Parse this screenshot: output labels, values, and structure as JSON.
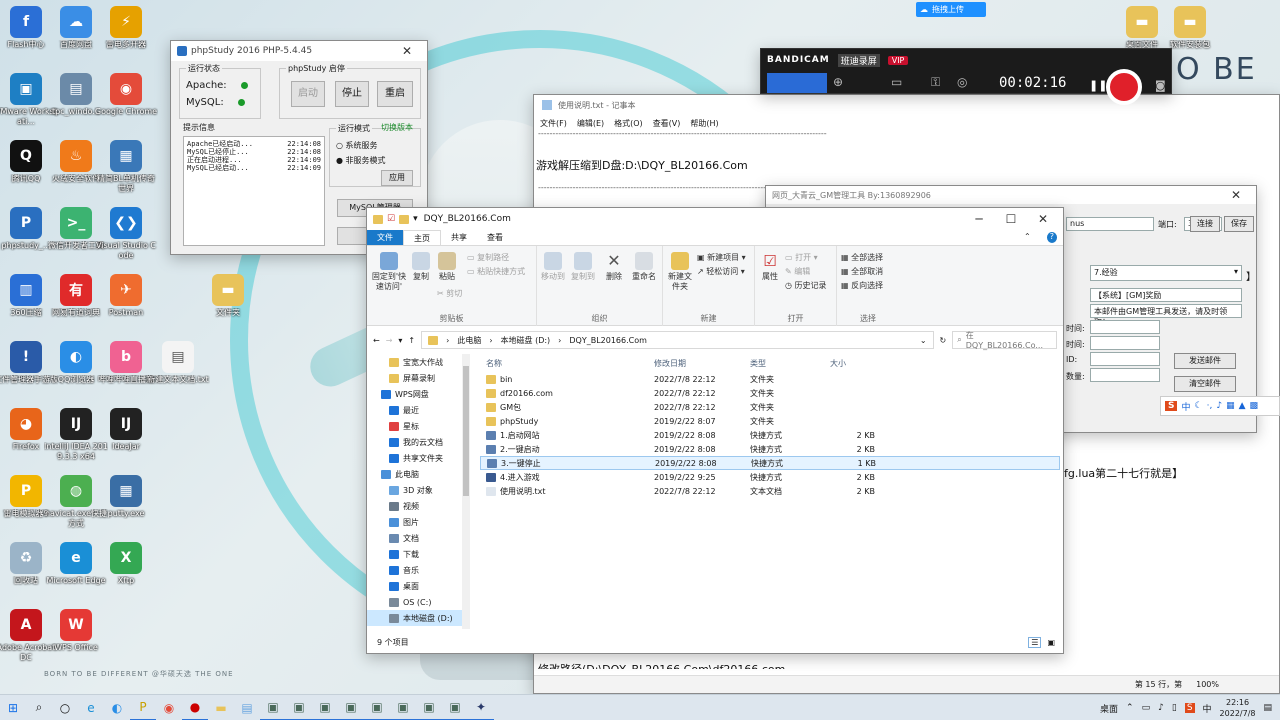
{
  "desktop": {
    "slogan": "BORN TO BE DIFFERENT @华硕天选 THE ONE",
    "icons": [
      {
        "label": "Flash中心",
        "color": "#2b6fd6",
        "glyph": "f"
      },
      {
        "label": "百度网盘",
        "color": "#3a8ee6",
        "glyph": "☁"
      },
      {
        "label": "雷电多开器",
        "color": "#e6a100",
        "glyph": "⚡"
      },
      {
        "label": "VMware Workstati...",
        "color": "#1e7fc4",
        "glyph": "▣"
      },
      {
        "label": "tpc_windo...",
        "color": "#6b8aa8",
        "glyph": "▤"
      },
      {
        "label": "Google Chrome",
        "color": "#e44b3a",
        "glyph": "◉"
      },
      {
        "label": "腾讯QQ",
        "color": "#111111",
        "glyph": "Q"
      },
      {
        "label": "火绒安全软件",
        "color": "#f07a1a",
        "glyph": "♨"
      },
      {
        "label": "精简BL单机传奇世界",
        "color": "#3a78b8",
        "glyph": "▦"
      },
      {
        "label": "phpstudy_...",
        "color": "#2a6fc0",
        "glyph": "P"
      },
      {
        "label": "微信开发者工具",
        "color": "#3cb371",
        "glyph": ">_"
      },
      {
        "label": "Visual Studio Code",
        "color": "#1f7ad1",
        "glyph": "❮❯"
      },
      {
        "label": "360压缩",
        "color": "#2a6fd6",
        "glyph": "▥"
      },
      {
        "label": "网易有道词典",
        "color": "#e02a2a",
        "glyph": "有"
      },
      {
        "label": "Postman",
        "color": "#ef6c2f",
        "glyph": "✈"
      },
      {
        "label": "文件夹",
        "color": "#e8c35a",
        "glyph": "▬"
      },
      {
        "label": "文件管理器手游版",
        "color": "#2a5ba8",
        "glyph": "!"
      },
      {
        "label": "QQ浏览器",
        "color": "#2a8ee6",
        "glyph": "◐"
      },
      {
        "label": "哔哩哔哩直播姬",
        "color": "#f06292",
        "glyph": "b"
      },
      {
        "label": "新建文本文档.txt",
        "color": "#eeeeee",
        "glyph": "▤"
      },
      {
        "label": "Firefox",
        "color": "#e8651a",
        "glyph": "◕"
      },
      {
        "label": "IntelliJ IDEA 2019.3.3 x64",
        "color": "#222222",
        "glyph": "IJ"
      },
      {
        "label": "IdeaJar",
        "color": "#222222",
        "glyph": "IJ"
      },
      {
        "label": "雷电模拟器9",
        "color": "#f2b600",
        "glyph": "P"
      },
      {
        "label": "navicat.exe快捷方式",
        "color": "#4caf50",
        "glyph": "◍"
      },
      {
        "label": "putty.exe",
        "color": "#3a6ea5",
        "glyph": "▦"
      },
      {
        "label": "回收站",
        "color": "#9bb4c8",
        "glyph": "♻"
      },
      {
        "label": "Microsoft Edge",
        "color": "#1a8fd6",
        "glyph": "e"
      },
      {
        "label": "Xftp",
        "color": "#34a853",
        "glyph": "X"
      },
      {
        "label": "Adobe Acrobat DC",
        "color": "#c4161c",
        "glyph": "A"
      },
      {
        "label": "WPS Office",
        "color": "#e53935",
        "glyph": "W"
      },
      {
        "label": "桌面文件",
        "color": "#e8c35a",
        "glyph": "▬"
      },
      {
        "label": "软件安装包",
        "color": "#e8c35a",
        "glyph": "▬"
      }
    ]
  },
  "upload_button": "拖拽上传",
  "brand_text": "O BE",
  "phpstudy": {
    "title": "phpStudy 2016  PHP-5.4.45",
    "status_legend": "运行状态",
    "apache": "Apache:",
    "mysql": "MySQL:",
    "start_legend": "phpStudy 启停",
    "start": "启动",
    "stop": "停止",
    "restart": "重启",
    "log_legend": "提示信息",
    "logs": [
      {
        "msg": "Apache已经启动...",
        "time": "22:14:08"
      },
      {
        "msg": "MySQL已经停止...",
        "time": "22:14:08"
      },
      {
        "msg": "正在启动进程...",
        "time": "22:14:09"
      },
      {
        "msg": "MySQL已经启动...",
        "time": "22:14:09"
      }
    ],
    "mode_legend": "运行模式",
    "switch_version": "切换版本",
    "mode_system": "系统服务",
    "mode_nonservice": "非服务模式",
    "apply": "应用",
    "mysql_manager": "MySQL管理器",
    "other": "其他"
  },
  "notepad": {
    "title": "使用说明.txt - 记事本",
    "menu": [
      "文件(F)",
      "编辑(E)",
      "格式(O)",
      "查看(V)",
      "帮助(H)"
    ],
    "dashes": "----------------------------------------------------------------------------------------------------",
    "line1": "游戏解压缩到D盘:D:\\DQY_BL20166.Com",
    "line_right": "cfg.lua第二十七行就是】",
    "line_bottom": "修改路径(D:\\DQY_BL20166.Com\\df20166.com",
    "status_pos": "第 15 行，第",
    "status_zoom": "100%"
  },
  "gm": {
    "title": "网页_大青云_GM管理工具 By:1360892906",
    "host_value": "nus",
    "port_label": "端口:",
    "port_value": "3306",
    "connect": "连接",
    "save": "保存",
    "select_value": "7.经验",
    "system_label": "【系统】[GM]奖励",
    "mail_text": "本邮件由GM管理工具发送，请及时领取！",
    "labels": [
      "时间:",
      "时间:",
      "ID:",
      "数量:"
    ],
    "send_mail": "发送邮件",
    "clear_mail": "清空邮件",
    "bracket": "】"
  },
  "bandicam": {
    "brand": "BANDICAM",
    "tag": "班迪录屏",
    "vip": "VIP",
    "timer": "00:02:16"
  },
  "ime": {
    "label": "中"
  },
  "explorer": {
    "title": "DQY_BL20166.Com",
    "tabs": [
      "文件",
      "主页",
      "共享",
      "查看"
    ],
    "ribbon": {
      "pin": "固定到'快速访问'",
      "copy": "复制",
      "paste": "粘贴",
      "copy_path": "复制路径",
      "paste_shortcut": "粘贴快捷方式",
      "cut": "剪切",
      "clipboard": "剪贴板",
      "move_to": "移动到",
      "copy_to": "复制到",
      "delete": "删除",
      "rename": "重命名",
      "organize": "组织",
      "new_folder": "新建文件夹",
      "new_item": "新建项目",
      "easy_access": "轻松访问",
      "new": "新建",
      "properties": "属性",
      "open": "打开",
      "edit": "编辑",
      "history": "历史记录",
      "open_group": "打开",
      "select_all": "全部选择",
      "select_none": "全部取消",
      "invert": "反向选择",
      "select_group": "选择"
    },
    "path": [
      "此电脑",
      "本地磁盘 (D:)",
      "DQY_BL20166.Com"
    ],
    "search_placeholder": "在 DQY_BL20166.Co...",
    "nav": [
      {
        "label": "宝宽大作战",
        "color": "#e8c35a",
        "indent": 1
      },
      {
        "label": "屏幕录制",
        "color": "#e8c35a",
        "indent": 1
      },
      {
        "label": "WPS网盘",
        "color": "#1e73d8",
        "indent": 0
      },
      {
        "label": "最近",
        "color": "#1e73d8",
        "indent": 1
      },
      {
        "label": "星标",
        "color": "#e04040",
        "indent": 1
      },
      {
        "label": "我的云文档",
        "color": "#1e73d8",
        "indent": 1
      },
      {
        "label": "共享文件夹",
        "color": "#1e73d8",
        "indent": 1
      },
      {
        "label": "此电脑",
        "color": "#4a90d9",
        "indent": 0
      },
      {
        "label": "3D 对象",
        "color": "#6aa6e0",
        "indent": 1
      },
      {
        "label": "视频",
        "color": "#6a7a8a",
        "indent": 1
      },
      {
        "label": "图片",
        "color": "#4a90d9",
        "indent": 1
      },
      {
        "label": "文档",
        "color": "#6a8ab0",
        "indent": 1
      },
      {
        "label": "下载",
        "color": "#1e73d8",
        "indent": 1
      },
      {
        "label": "音乐",
        "color": "#1e73d8",
        "indent": 1
      },
      {
        "label": "桌面",
        "color": "#1e73d8",
        "indent": 1
      },
      {
        "label": "OS (C:)",
        "color": "#7a8a9a",
        "indent": 1
      },
      {
        "label": "本地磁盘 (D:)",
        "color": "#7a8a9a",
        "indent": 1,
        "selected": true
      }
    ],
    "columns": [
      "名称",
      "修改日期",
      "类型",
      "大小"
    ],
    "files": [
      {
        "name": "bin",
        "date": "2022/7/8 22:12",
        "type": "文件夹",
        "size": "",
        "color": "#e8c35a"
      },
      {
        "name": "df20166.com",
        "date": "2022/7/8 22:12",
        "type": "文件夹",
        "size": "",
        "color": "#e8c35a"
      },
      {
        "name": "GM包",
        "date": "2022/7/8 22:12",
        "type": "文件夹",
        "size": "",
        "color": "#e8c35a"
      },
      {
        "name": "phpStudy",
        "date": "2019/2/22 8:07",
        "type": "文件夹",
        "size": "",
        "color": "#e8c35a"
      },
      {
        "name": "1.启动网站",
        "date": "2019/2/22 8:08",
        "type": "快捷方式",
        "size": "2 KB",
        "color": "#5b7fb0"
      },
      {
        "name": "2.一键启动",
        "date": "2019/2/22 8:08",
        "type": "快捷方式",
        "size": "2 KB",
        "color": "#5b7fb0"
      },
      {
        "name": "3.一键停止",
        "date": "2019/2/22 8:08",
        "type": "快捷方式",
        "size": "1 KB",
        "color": "#5b7fb0",
        "selected": true
      },
      {
        "name": "4.进入游戏",
        "date": "2019/2/22 9:25",
        "type": "快捷方式",
        "size": "2 KB",
        "color": "#3a5a90"
      },
      {
        "name": "使用说明.txt",
        "date": "2022/7/8 22:12",
        "type": "文本文档",
        "size": "2 KB",
        "color": "#dfe6ee"
      }
    ],
    "status": "9 个项目"
  },
  "taskbar": {
    "tray_desktop": "桌面",
    "time": "22:16",
    "date": "2022/7/8"
  }
}
